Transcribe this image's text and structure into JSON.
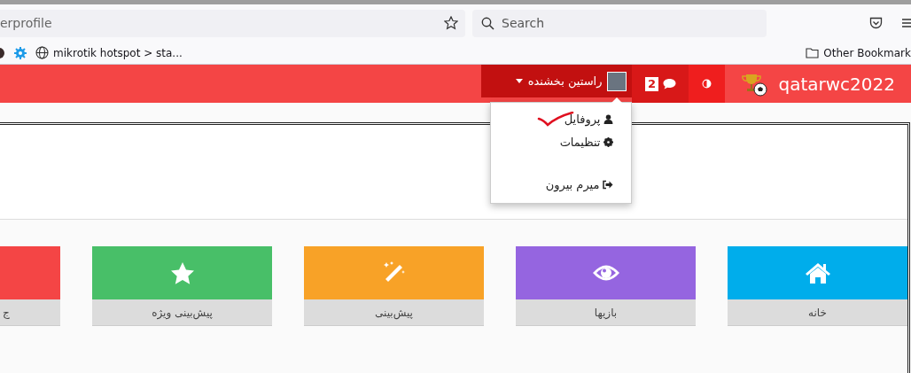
{
  "browser": {
    "url": "erprofile",
    "search_placeholder": "Search",
    "bookmarks": [
      {
        "label": "mikrotik hotspot > sta..."
      }
    ],
    "other_bookmarks": "Other Bookmark"
  },
  "navbar": {
    "brand": "qatarwc2022",
    "message_count": "2",
    "user_name": "راستین بخشنده",
    "expanded": true,
    "menu": [
      {
        "kind": "profile",
        "label": "پروفایل"
      },
      {
        "kind": "settings",
        "label": "تنظیمات"
      },
      {
        "kind": "logout",
        "label": "میرم بیرون"
      }
    ]
  },
  "tiles": [
    {
      "kind": "home",
      "label": "خانه",
      "color": "#00adeb"
    },
    {
      "kind": "eye",
      "label": "بازیها",
      "color": "#9565e0"
    },
    {
      "kind": "wand",
      "label": "پیش‌بینی",
      "color": "#f8a227"
    },
    {
      "kind": "star",
      "label": "پیش‌بینی ویژه",
      "color": "#48bf68"
    },
    {
      "kind": "none",
      "label": "ج",
      "color": "#f44545"
    }
  ]
}
